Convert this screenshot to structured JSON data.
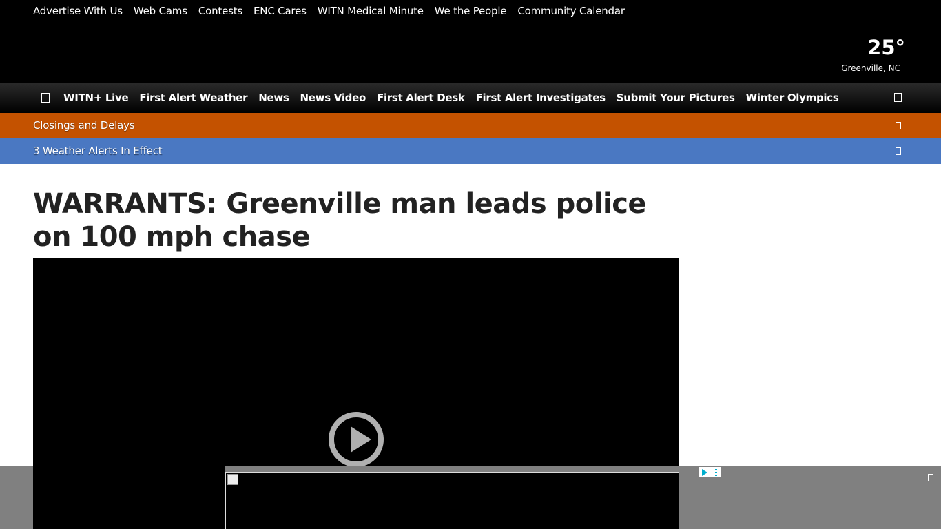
{
  "top_links": [
    "Advertise With Us",
    "Web Cams",
    "Contests",
    "ENC Cares",
    "WITN Medical Minute",
    "We the People",
    "Community Calendar"
  ],
  "weather": {
    "temperature": "25°",
    "location": "Greenville, NC"
  },
  "nav": {
    "menu_icon": "menu-icon",
    "items": [
      "WITN+ Live",
      "First Alert Weather",
      "News",
      "News Video",
      "First Alert Desk",
      "First Alert Investigates",
      "Submit Your Pictures",
      "Winter Olympics"
    ],
    "search_icon": "search-icon"
  },
  "banners": {
    "closings": {
      "label": "Closings and Delays",
      "color": "#c45200"
    },
    "alerts": {
      "label": "3 Weather Alerts In Effect",
      "color": "#4a78c2"
    }
  },
  "article": {
    "headline": "WARRANTS: Greenville man leads police on 100 mph chase"
  },
  "video": {
    "play_icon": "play-icon"
  },
  "ad": {
    "adchoices_icon": "adchoices-icon",
    "close_icon": "close-icon"
  }
}
